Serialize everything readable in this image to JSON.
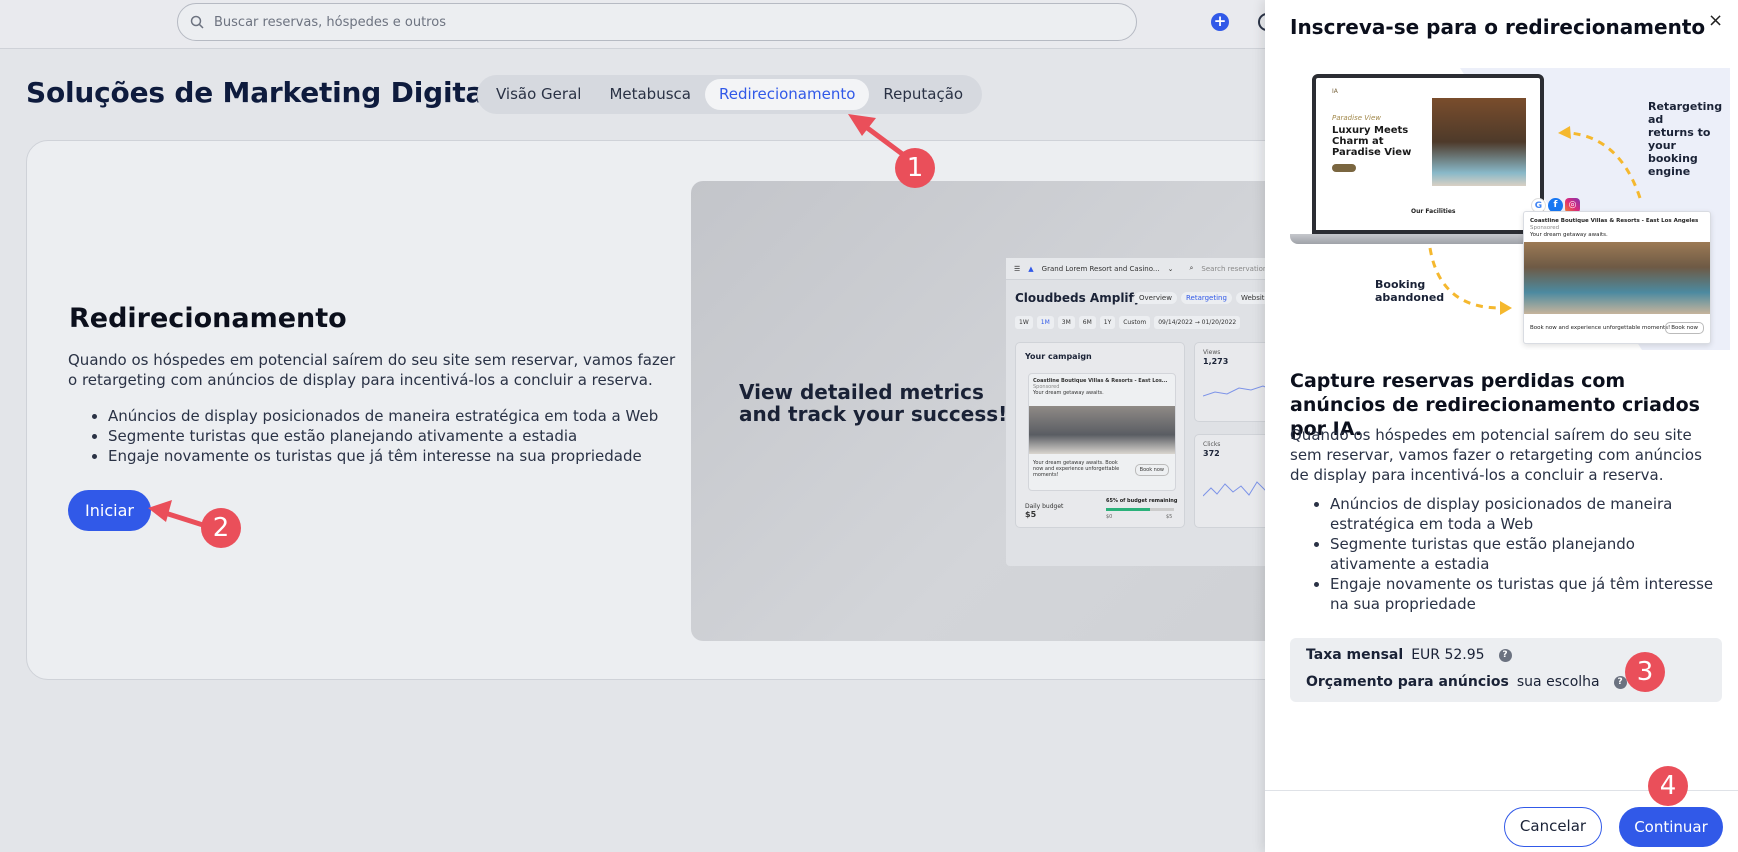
{
  "topbar": {
    "search_placeholder": "Buscar reservas, hóspedes e outros",
    "add_label": "+"
  },
  "page": {
    "title": "Soluções de Marketing Digital",
    "tabs": [
      {
        "label": "Visão Geral",
        "active": false
      },
      {
        "label": "Metabusca",
        "active": false
      },
      {
        "label": "Redirecionamento",
        "active": true
      },
      {
        "label": "Reputação",
        "active": false
      }
    ]
  },
  "card": {
    "title": "Redirecionamento",
    "description": "Quando os hóspedes em potencial saírem do seu site sem reservar, vamos fazer o retargeting com anúncios de display para incentivá-los a concluir a reserva.",
    "bullets": [
      "Anúncios de display posicionados de maneira estratégica em toda a Web",
      "Segmente turistas que estão planejando ativamente a estadia",
      "Engaje novamente os turistas que já têm interesse na sua propriedade"
    ],
    "start_label": "Iniciar",
    "preview": {
      "headline": "View detailed metrics\nand track your success!",
      "mock": {
        "property": "Grand Lorem Resort and Casino...",
        "search": "Search reservations, gu",
        "app_title": "Cloudbeds Amplify",
        "tabs": [
          "Overview",
          "Retargeting",
          "Websites"
        ],
        "selected_tab": "Retargeting",
        "ranges": [
          "1W",
          "1M",
          "3M",
          "6M",
          "1Y",
          "Custom",
          "09/14/2022 → 01/20/2022"
        ],
        "selected_range": "1M",
        "campaign_title": "Your campaign",
        "ad_title": "Coastline Boutique Villas & Resorts - East Los...",
        "ad_sponsored": "Sponsored",
        "ad_tagline": "Your dream getaway awaits.",
        "ad_footer": "Your dream getaway awaits. Book now and experience unforgettable moments!",
        "ad_book": "Book now",
        "budget_label": "Daily budget",
        "budget_value": "$5",
        "budget_note": "65% of budget remaining",
        "budget_remaining_pct": 65,
        "budget_min": "$0",
        "budget_max": "$5",
        "views_label": "Views",
        "views_value": "1,273",
        "clicks_label": "Clicks",
        "clicks_value": "372"
      }
    }
  },
  "drawer": {
    "title": "Inscreva-se para o redirecionamento",
    "close_label": "×",
    "hero": {
      "site_logo": "IA",
      "site_tag": "Paradise View",
      "site_heading": "Luxury Meets\nCharm at\nParadise View",
      "site_facilities": "Our Facilities",
      "note_top": "Retargeting ad\nreturns to your\nbooking engine",
      "note_bottom": "Booking\nabandoned",
      "ad_title": "Coastline Boutique Villas & Resorts - East Los Angeles",
      "ad_sponsored": "Sponsored",
      "ad_tagline": "Your dream getaway awaits.",
      "ad_footer": "Book now and experience unforgettable moments!",
      "ad_book": "Book now",
      "social": [
        "G",
        "f",
        "◎"
      ]
    },
    "heading": "Capture reservas perdidas com anúncios de redirecionamento criados por IA.",
    "description": "Quando os hóspedes em potencial saírem do seu site sem reservar, vamos fazer o retargeting com anúncios de display para incentivá-los a concluir a reserva.",
    "bullets": [
      "Anúncios de display posicionados de maneira estratégica em toda a Web",
      "Segmente turistas que estão planejando ativamente a estadia",
      "Engaje novamente os turistas que já têm interesse na sua propriedade"
    ],
    "fees": {
      "monthly_label": "Taxa mensal",
      "monthly_value": "EUR 52.95",
      "budget_label": "Orçamento para anúncios",
      "budget_value": "sua escolha"
    },
    "cancel_label": "Cancelar",
    "continue_label": "Continuar"
  },
  "annotations": [
    "1",
    "2",
    "3",
    "4"
  ],
  "colors": {
    "accent": "#3159e8",
    "annotation": "#ea4f5a",
    "title": "#0e1b3d"
  }
}
